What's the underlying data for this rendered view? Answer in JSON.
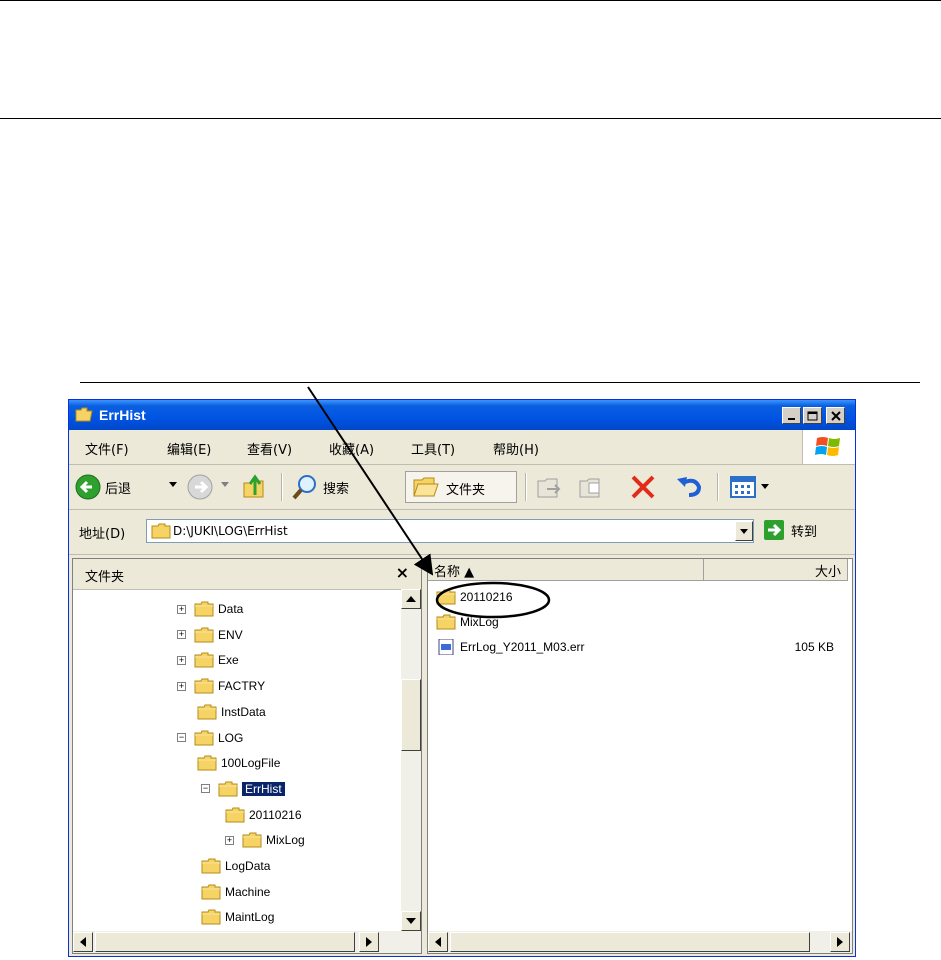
{
  "window": {
    "title": "ErrHist"
  },
  "menu": [
    "文件(F)",
    "编辑(E)",
    "查看(V)",
    "收藏(A)",
    "工具(T)",
    "帮助(H)"
  ],
  "toolbar": {
    "back_label": "后退",
    "search_label": "搜索",
    "folders_label": "文件夹"
  },
  "address": {
    "label": "地址(D)",
    "path": "D:\\JUKI\\LOG\\ErrHist",
    "go_label": "转到"
  },
  "folder_pane": {
    "title": "文件夹",
    "close": "×",
    "items": [
      {
        "label": "Data",
        "expander": "+"
      },
      {
        "label": "ENV",
        "expander": "+"
      },
      {
        "label": "Exe",
        "expander": "+"
      },
      {
        "label": "FACTRY",
        "expander": "+"
      },
      {
        "label": "InstData",
        "expander": ""
      },
      {
        "label": "LOG",
        "expander": "−"
      },
      {
        "label": "100LogFile",
        "expander": ""
      },
      {
        "label": "ErrHist",
        "expander": "−"
      },
      {
        "label": "20110216",
        "expander": ""
      },
      {
        "label": "MixLog",
        "expander": "+"
      },
      {
        "label": "LogData",
        "expander": ""
      },
      {
        "label": "Machine",
        "expander": ""
      },
      {
        "label": "MaintLog",
        "expander": ""
      }
    ]
  },
  "file_list": {
    "columns": [
      "名称 ▲",
      "大小"
    ],
    "rows": [
      {
        "name": "20110216",
        "size": ""
      },
      {
        "name": "MixLog",
        "size": ""
      },
      {
        "name": "ErrLog_Y2011_M03.err",
        "size": "105 KB"
      }
    ]
  },
  "colors": {
    "titlebar": "#0054e3",
    "selection": "#0a246a",
    "chrome": "#ece9d8"
  }
}
